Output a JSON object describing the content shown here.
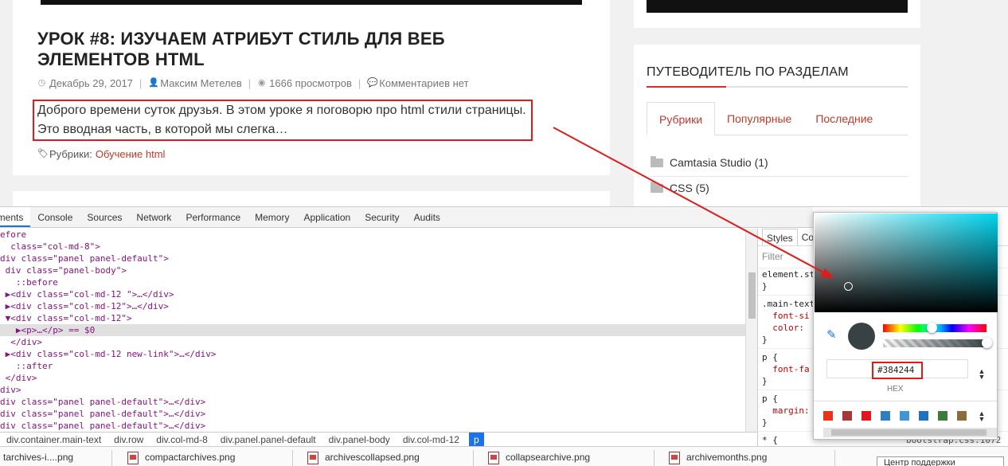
{
  "post": {
    "title": "Урок #8: Изучаем атрибут стиль для веб элементов HTML",
    "date": "Декабрь 29, 2017",
    "author": "Максим Метелев",
    "views": "1666 просмотров",
    "comments": "Комментариев нет",
    "excerpt": "Доброго времени суток друзья. В этом уроке я поговорю про html стили страницы. Это вводная часть, в которой мы слегка…",
    "categories_label": "Рубрики:",
    "category_link": "Обучение html"
  },
  "sidebar": {
    "title": "ПУТЕВОДИТЕЛЬ ПО РАЗДЕЛАМ",
    "tabs": [
      {
        "label": "Рубрики"
      },
      {
        "label": "Популярные"
      },
      {
        "label": "Последние"
      }
    ],
    "categories": [
      {
        "label": "Camtasia Studio (1)"
      },
      {
        "label": "CSS (5)"
      }
    ]
  },
  "devtools": {
    "tabs": [
      {
        "label": "ements"
      },
      {
        "label": "Console"
      },
      {
        "label": "Sources"
      },
      {
        "label": "Network"
      },
      {
        "label": "Performance"
      },
      {
        "label": "Memory"
      },
      {
        "label": "Application"
      },
      {
        "label": "Security"
      },
      {
        "label": "Audits"
      }
    ],
    "dom_lines": [
      {
        "text": "efore"
      },
      {
        "text": "  class=\"col-md-8\">"
      },
      {
        "text": "div class=\"panel panel-default\">"
      },
      {
        "text": " div class=\"panel-body\">"
      },
      {
        "text": "   ::before"
      },
      {
        "text": " ▶<div class=\"col-md-12 \">…</div>"
      },
      {
        "text": " ▶<div class=\"col-md-12\">…</div>"
      },
      {
        "text": " ▼<div class=\"col-md-12\">"
      },
      {
        "text": "   ▶<p>…</p> == $0"
      },
      {
        "text": "  </div>"
      },
      {
        "text": " ▶<div class=\"col-md-12 new-link\">…</div>"
      },
      {
        "text": "   ::after"
      },
      {
        "text": " </div>"
      },
      {
        "text": "div>"
      },
      {
        "text": "div class=\"panel panel-default\">…</div>"
      },
      {
        "text": "div class=\"panel panel-default\">…</div>"
      },
      {
        "text": "div class=\"panel panel-default\">…</div>"
      }
    ],
    "breadcrumbs": [
      {
        "label": "div.container.main-text"
      },
      {
        "label": "div.row"
      },
      {
        "label": "div.col-md-8"
      },
      {
        "label": "div.panel.panel-default"
      },
      {
        "label": "div.panel-body"
      },
      {
        "label": "div.col-md-12"
      },
      {
        "label": "p"
      }
    ],
    "styles_tabs": [
      {
        "label": "Styles"
      },
      {
        "label": "Co"
      }
    ],
    "filter_placeholder": "Filter",
    "style_lines": [
      {
        "text": "element.st"
      },
      {
        "text": "}"
      },
      {
        "text": ".main-text"
      },
      {
        "text": "  font-si"
      },
      {
        "text": "  color:"
      },
      {
        "text": "}"
      },
      {
        "text": "p {"
      },
      {
        "text": "  font-fa"
      },
      {
        "text": "}"
      },
      {
        "text": "p {"
      },
      {
        "text": "  margin:"
      },
      {
        "text": "}"
      },
      {
        "text": "* {"
      }
    ],
    "bootstrap_ref": "bootstrap.css:1072"
  },
  "color_picker": {
    "hex_value": "#384244",
    "format_label": "HEX",
    "current_color": "#384244",
    "palette": [
      "#e8341c",
      "#a5393a",
      "#e0161c",
      "#2f7fc1",
      "#4396d3",
      "#1f74bd",
      "#3f7a3a",
      "#8c6b3f"
    ]
  },
  "downloads": {
    "items": [
      {
        "label": "tarchives-i....png"
      },
      {
        "label": "compactarchives.png"
      },
      {
        "label": "archivescollapsed.png"
      },
      {
        "label": "collapsearchive.png"
      },
      {
        "label": "archivemonths.png"
      }
    ],
    "help_center": "Центр поддержки"
  }
}
